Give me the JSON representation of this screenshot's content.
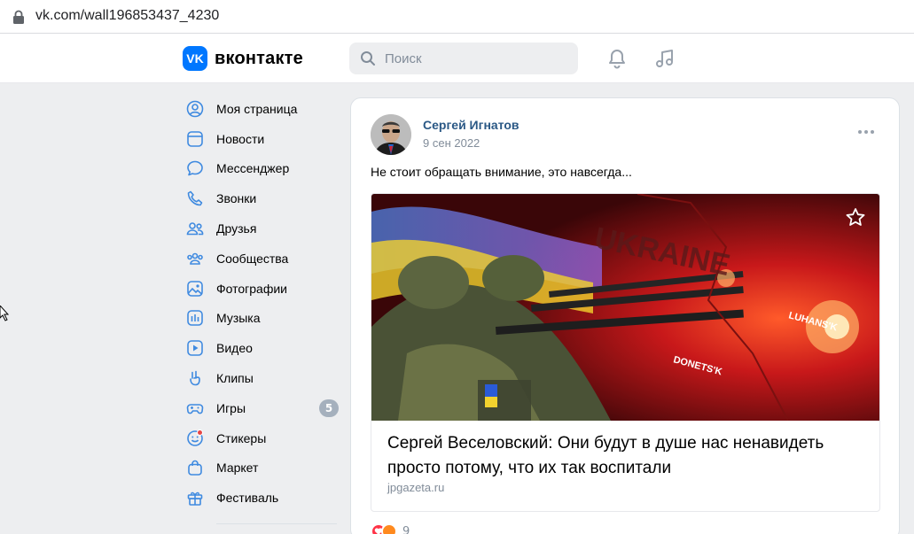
{
  "browser": {
    "url": "vk.com/wall196853437_4230"
  },
  "header": {
    "logo_mark": "VK",
    "logo_text": "вконтакте",
    "search_placeholder": "Поиск",
    "icons": [
      "bell-icon",
      "music-icon"
    ]
  },
  "sidebar": {
    "items": [
      {
        "label": "Моя страница",
        "icon": "user-circle-icon"
      },
      {
        "label": "Новости",
        "icon": "news-icon"
      },
      {
        "label": "Мессенджер",
        "icon": "message-icon"
      },
      {
        "label": "Звонки",
        "icon": "phone-icon"
      },
      {
        "label": "Друзья",
        "icon": "friends-icon"
      },
      {
        "label": "Сообщества",
        "icon": "communities-icon"
      },
      {
        "label": "Фотографии",
        "icon": "photo-icon"
      },
      {
        "label": "Музыка",
        "icon": "music-bars-icon"
      },
      {
        "label": "Видео",
        "icon": "video-icon"
      },
      {
        "label": "Клипы",
        "icon": "clips-icon"
      },
      {
        "label": "Игры",
        "icon": "gamepad-icon",
        "badge": "5"
      },
      {
        "label": "Стикеры",
        "icon": "sticker-icon"
      },
      {
        "label": "Маркет",
        "icon": "market-bag-icon"
      },
      {
        "label": "Фестиваль",
        "icon": "gift-icon"
      }
    ]
  },
  "post": {
    "author": "Сергей Игнатов",
    "date": "9 сен 2022",
    "text": "Не стоит обращать внимание, это навсегда...",
    "attachment": {
      "image_caption_words": [
        "UKRAINE",
        "LUHANS'K",
        "DONETS'K"
      ],
      "title": "Сергей Веселовский: Они будут в душе нас ненавидеть просто потому, что их так воспитали",
      "domain": "jpgazeta.ru"
    },
    "reactions": {
      "count": "9"
    }
  },
  "colors": {
    "vk_blue": "#0077ff",
    "link_blue": "#2a5885",
    "bg": "#edeef0",
    "muted": "#818c99"
  }
}
